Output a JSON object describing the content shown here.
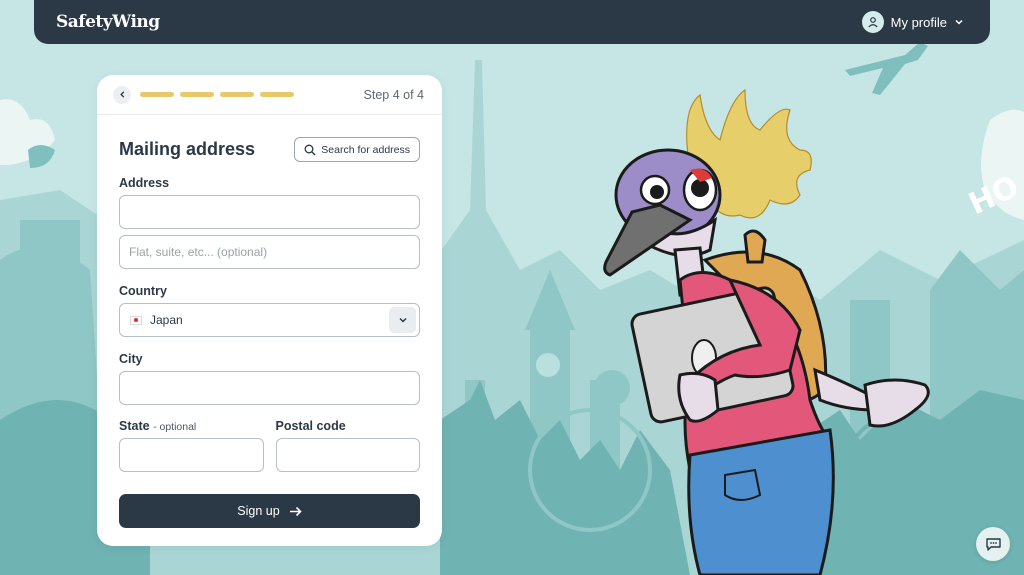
{
  "brand": {
    "logo_text": "SafetyWing"
  },
  "nav": {
    "profile_label": "My profile"
  },
  "form": {
    "step_text": "Step 4 of 4",
    "progress_segments": 4,
    "title": "Mailing address",
    "search_button_label": "Search for address",
    "address_label": "Address",
    "address_value": "",
    "address2_placeholder": "Flat, suite, etc... (optional)",
    "country_label": "Country",
    "country_value": "Japan",
    "city_label": "City",
    "city_value": "",
    "state_label": "State",
    "state_optional": "- optional",
    "state_value": "",
    "postal_label": "Postal code",
    "postal_value": "",
    "submit_label": "Sign up"
  },
  "icons": {
    "back": "chevron-left-icon",
    "search": "search-icon",
    "select": "chevron-down-icon",
    "submit": "arrow-right-icon",
    "profile": "user-icon",
    "chat": "chat-icon"
  },
  "colors": {
    "nav_bg": "#2b3947",
    "progress": "#e7c96a",
    "background": "#c6e6e6",
    "skyline": "#7fbfbe",
    "button": "#2b3947"
  }
}
